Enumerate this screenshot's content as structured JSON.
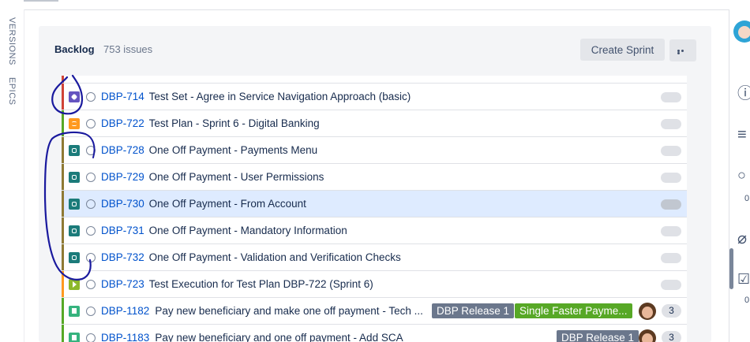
{
  "left_rail": {
    "versions_label": "VERSIONS",
    "epics_label": "EPICS"
  },
  "backlog": {
    "title": "Backlog",
    "issue_count": "753 issues",
    "create_sprint_label": "Create Sprint",
    "more_icon": "more-horizontal-icon"
  },
  "issues": [
    {
      "key": "DBP-714",
      "summary": "Test Set - Agree in Service Navigation Approach (basic)",
      "type": "test-set-icon",
      "epic_color": "#d04437"
    },
    {
      "key": "DBP-722",
      "summary": "Test Plan - Sprint 6 - Digital Banking",
      "type": "test-plan-icon",
      "epic_color": "#57a826"
    },
    {
      "key": "DBP-728",
      "summary": "One Off Payment - Payments Menu",
      "type": "payment-icon",
      "epic_color": "#8f7a34"
    },
    {
      "key": "DBP-729",
      "summary": "One Off Payment - User Permissions",
      "type": "payment-icon",
      "epic_color": "#8f7a34"
    },
    {
      "key": "DBP-730",
      "summary": "One Off Payment - From Account",
      "type": "payment-icon",
      "epic_color": "#8f7a34",
      "selected": true
    },
    {
      "key": "DBP-731",
      "summary": "One Off Payment - Mandatory Information",
      "type": "payment-icon",
      "epic_color": "#8f7a34"
    },
    {
      "key": "DBP-732",
      "summary": "One Off Payment - Validation and Verification Checks",
      "type": "payment-icon",
      "epic_color": "#8f7a34"
    },
    {
      "key": "DBP-723",
      "summary": "Test Execution for Test Plan DBP-722 (Sprint 6)",
      "type": "test-execution-icon",
      "epic_color": "#ff991f"
    },
    {
      "key": "DBP-1182",
      "summary": "Pay new beneficiary and make one off payment - Tech ...",
      "type": "story-icon",
      "epic_color": "#57a826",
      "version": "DBP Release 1",
      "epic": "Single Faster Payme...",
      "points": "3"
    },
    {
      "key": "DBP-1183",
      "summary": "Pay new beneficiary and one off payment - Add SCA",
      "type": "story-icon",
      "epic_color": "#57a826",
      "version": "DBP Release 1",
      "points": "3"
    }
  ],
  "right_rail": {
    "count_a": "0",
    "count_b": "0"
  },
  "colors": {
    "annotation_ink": "#1a1a9e",
    "key_link": "#0052cc",
    "selected_row": "#deebff"
  }
}
